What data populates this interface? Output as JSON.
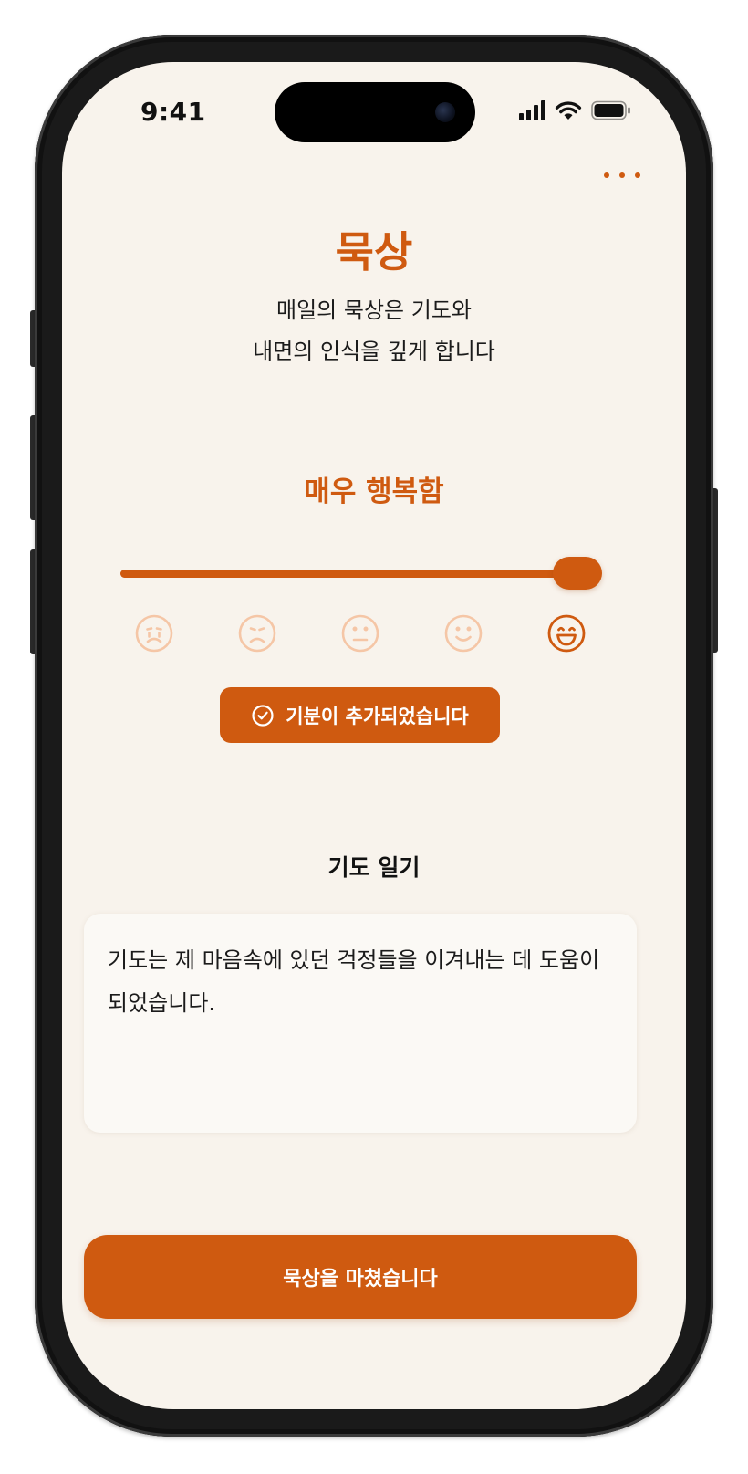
{
  "status_bar": {
    "time": "9:41"
  },
  "header": {
    "title": "묵상",
    "subtitle_line1": "매일의 묵상은 기도와",
    "subtitle_line2": "내면의 인식을 깊게 합니다"
  },
  "mood": {
    "label": "매우 행복함",
    "slider_value_fraction": 1.0,
    "selected_index": 4,
    "faces": [
      "crying-face-icon",
      "sad-face-icon",
      "neutral-face-icon",
      "smile-face-icon",
      "grin-face-icon"
    ],
    "confirm_label": "기분이 추가되었습니다"
  },
  "journal": {
    "title": "기도 일기",
    "text": "기도는 제 마음속에 있던 걱정들을 이겨내는 데 도움이 되었습니다."
  },
  "footer": {
    "finish_label": "묵상을 마쳤습니다"
  },
  "colors": {
    "accent": "#cf5a10",
    "accent_faded": "#f5c6a6",
    "background": "#f8f3ec",
    "track": "#d9d2c8"
  }
}
